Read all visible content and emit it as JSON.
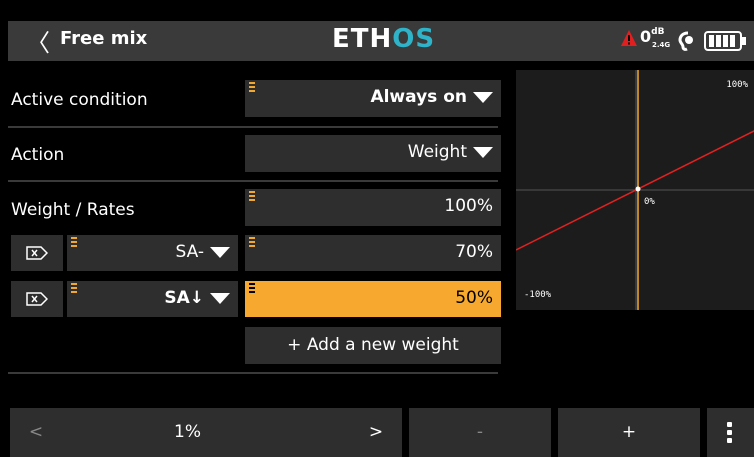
{
  "header": {
    "back_glyph": "〈",
    "title": "Free mix",
    "logo_main": "ETH",
    "logo_accent": "OS",
    "rssi_value": "0",
    "rssi_unit": "dB",
    "rssi_band": "2.4G"
  },
  "form": {
    "active_condition_label": "Active condition",
    "active_condition_value": "Always on",
    "action_label": "Action",
    "action_value": "Weight",
    "weight_rates_label": "Weight / Rates",
    "weight_rates_value": "100%",
    "rates": [
      {
        "switch": "SA-",
        "value": "70%"
      },
      {
        "switch": "SA↓",
        "value": "50%"
      }
    ],
    "add_weight_label": "+ Add a new weight"
  },
  "graph": {
    "top_label": "100%",
    "center_label": "0%",
    "bottom_label": "-100%"
  },
  "footer": {
    "prev_glyph": "<",
    "step_value": "1%",
    "next_glyph": ">",
    "minus_label": "-",
    "plus_label": "+"
  },
  "colors": {
    "accent": "#f6a92e",
    "curve": "#e02020",
    "background": "#000000",
    "panel": "#2e2e2e",
    "logo_accent": "#2fb3c9"
  }
}
